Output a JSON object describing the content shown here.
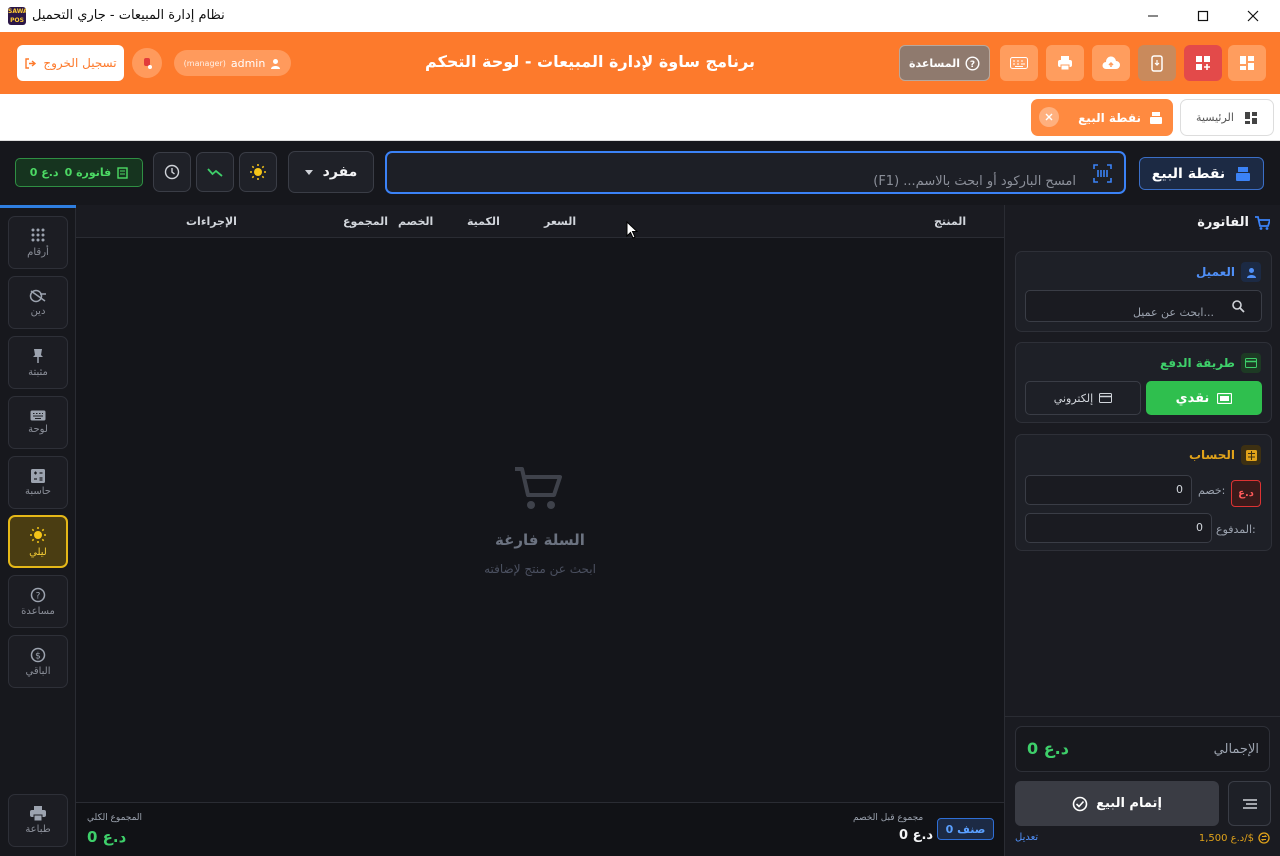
{
  "window": {
    "title": "نظام إدارة المبيعات - جاري التحميل",
    "logo_text": "SAWA POS"
  },
  "header": {
    "app_title": "برنامج ساوة لإدارة المبيعات - لوحة التحكم",
    "help_label": "المساعدة",
    "user_name": "admin",
    "user_role": "(manager)",
    "logout_label": "تسجيل الخروج"
  },
  "tabs": {
    "home_label": "الرئيسية",
    "pos_label": "نقطة البيع"
  },
  "toolbar": {
    "pos_title": "نقطة البيع",
    "search_placeholder": "امسح الباركود أو ابحث بالاسم... (F1)",
    "unit_select": "مفرد",
    "invoice_count": "0 فاتورة",
    "invoice_total": "0 د.ع"
  },
  "sidebar": {
    "items": [
      {
        "label": "أرقام",
        "icon": "keypad-icon"
      },
      {
        "label": "دين",
        "icon": "debt-icon"
      },
      {
        "label": "مثبتة",
        "icon": "pin-icon"
      },
      {
        "label": "لوحة",
        "icon": "keyboard-icon"
      },
      {
        "label": "حاسبة",
        "icon": "calculator-icon"
      },
      {
        "label": "ليلي",
        "icon": "sun-icon"
      },
      {
        "label": "مساعدة",
        "icon": "help-icon"
      },
      {
        "label": "الباقي",
        "icon": "change-icon"
      }
    ],
    "print_label": "طباعة"
  },
  "cart": {
    "columns": {
      "product": "المنتج",
      "price": "السعر",
      "quantity": "الكمية",
      "discount": "الخصم",
      "total": "المجموع",
      "actions": "الإجراءات"
    },
    "empty_title": "السلة فارغة",
    "empty_subtitle": "ابحث عن منتج لإضافته"
  },
  "cart_footer": {
    "grand_total_label": "المجموع الكلي",
    "grand_total_value": "0 د.ع",
    "subtotal_label": "مجموع قبل الخصم",
    "subtotal_value": "0 د.ع",
    "items_count": "0 صنف"
  },
  "invoice_panel": {
    "title": "الفاتورة",
    "customer": {
      "title": "العميل",
      "search_placeholder": "ابحث عن عميل..."
    },
    "payment": {
      "title": "طريقة الدفع",
      "cash_label": "نقدي",
      "electronic_label": "إلكتروني",
      "selected": "cash"
    },
    "account": {
      "title": "الحساب",
      "discount_label": "خصم:",
      "discount_value": "0",
      "currency_badge": "د.ع",
      "paid_label": "المدفوع:",
      "paid_value": "0"
    },
    "total_label": "الإجمالي",
    "total_value": "0 د.ع",
    "complete_sale_label": "إتمام البيع",
    "exchange_rate": "1,500 د.ع/$",
    "edit_label": "تعديل"
  },
  "colors": {
    "header_orange": "#fd7a2c",
    "accent_blue": "#2f7fe0",
    "success_green": "#2fbf4e",
    "night_yellow": "#e5b818",
    "account_amber": "#e0a21a"
  }
}
